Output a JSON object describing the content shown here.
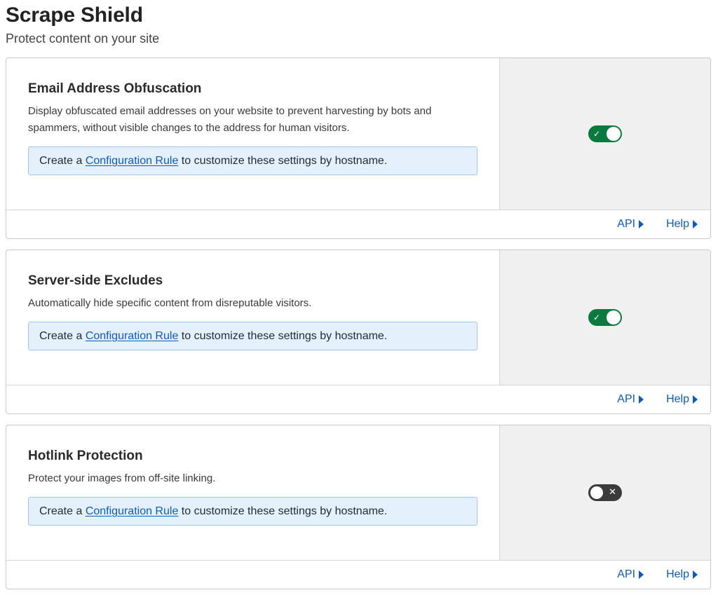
{
  "header": {
    "title": "Scrape Shield",
    "subtitle": "Protect content on your site"
  },
  "colors": {
    "toggle_on": "#0a7a3e",
    "toggle_off": "#3b3b3b",
    "link": "#0b5bbf",
    "info_bg": "#e4f1fd"
  },
  "cards": [
    {
      "title": "Email Address Obfuscation",
      "description_line1": "Display obfuscated email addresses on your website to prevent harvesting by bots and",
      "description_line2": "spammers, without visible changes to the address for human visitors.",
      "info_prefix": "Create a ",
      "info_link": "Configuration Rule",
      "info_suffix": " to customize these settings by hostname.",
      "toggle_state": "on",
      "toggle_icon": "check-icon",
      "api_label": "API",
      "help_label": "Help"
    },
    {
      "title": "Server-side Excludes",
      "description_line1": "Automatically hide specific content from disreputable visitors.",
      "description_line2": "",
      "info_prefix": "Create a ",
      "info_link": "Configuration Rule",
      "info_suffix": " to customize these settings by hostname.",
      "toggle_state": "on",
      "toggle_icon": "check-icon",
      "api_label": "API",
      "help_label": "Help"
    },
    {
      "title": "Hotlink Protection",
      "description_line1": "Protect your images from off-site linking.",
      "description_line2": "",
      "info_prefix": "Create a ",
      "info_link": "Configuration Rule",
      "info_suffix": " to customize these settings by hostname.",
      "toggle_state": "off",
      "toggle_icon": "x-icon",
      "api_label": "API",
      "help_label": "Help"
    }
  ]
}
